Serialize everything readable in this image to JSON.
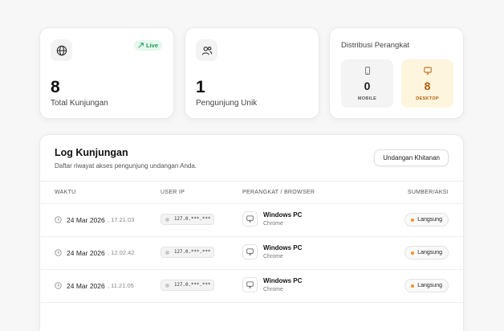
{
  "stats": {
    "total": {
      "value": "8",
      "label": "Total Kunjungan",
      "badge": "Live",
      "icon": "globe-icon"
    },
    "unique": {
      "value": "1",
      "label": "Pengunjung Unik",
      "icon": "users-icon"
    }
  },
  "devices": {
    "title": "Distribusi Perangkat",
    "mobile": {
      "count": "0",
      "label": "MOBILE",
      "icon": "smartphone-icon"
    },
    "desktop": {
      "count": "8",
      "label": "DESKTOP",
      "icon": "monitor-icon"
    }
  },
  "log": {
    "title": "Log Kunjungan",
    "subtitle": "Daftar riwayat akses pengunjung undangan Anda.",
    "button": "Undangan Khitanan",
    "columns": {
      "time": "WAKTU",
      "ip": "USER IP",
      "device": "PERANGKAT / BROWSER",
      "source": "SUMBER/AKSI"
    },
    "rows": [
      {
        "date": "24 Mar 2026",
        "time": ", 17.21.03",
        "ip": "127.0.***.***",
        "device": "Windows PC",
        "browser": "Chrome",
        "source": "Langsung"
      },
      {
        "date": "24 Mar 2026",
        "time": ", 12.02.42",
        "ip": "127.0.***.***",
        "device": "Windows PC",
        "browser": "Chrome",
        "source": "Langsung"
      },
      {
        "date": "24 Mar 2026",
        "time": ", 11.21.05",
        "ip": "127.0.***.***",
        "device": "Windows PC",
        "browser": "Chrome",
        "source": "Langsung"
      }
    ]
  },
  "colors": {
    "live_green": "#1a9a55",
    "desktop_accent": "#b35c0c",
    "source_dot": "#f39323"
  }
}
